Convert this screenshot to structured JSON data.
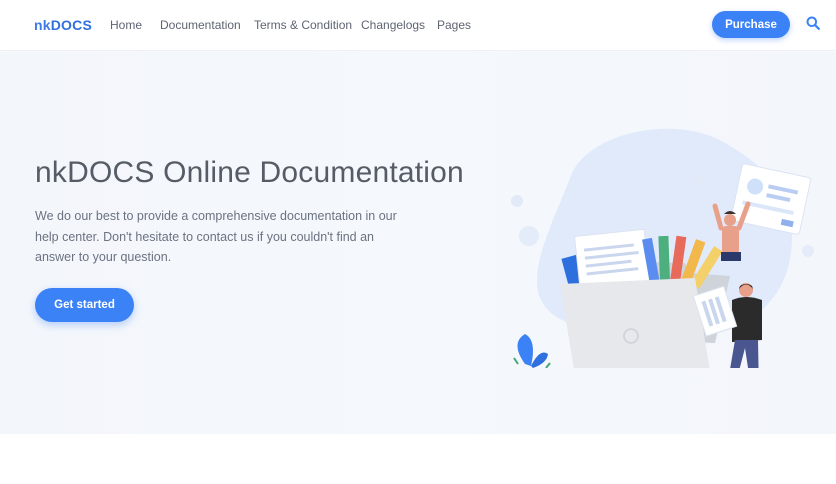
{
  "brand": {
    "prefix": "nk",
    "name": "DOCS"
  },
  "nav": {
    "items": [
      {
        "label": "Home"
      },
      {
        "label": "Documentation"
      },
      {
        "label": "Terms & Condition"
      },
      {
        "label": "Changelogs"
      },
      {
        "label": "Pages"
      }
    ],
    "purchase_label": "Purchase",
    "search_icon": "search-icon"
  },
  "hero": {
    "title": "nkDOCS Online Documentation",
    "description": "We do our best to provide a comprehensive documentation in our help center. Don't hesitate to contact us if you couldn't find an answer to your question.",
    "cta_label": "Get started"
  },
  "colors": {
    "accent": "#3b82f6",
    "brand": "#3d7be6",
    "hero_background": "#f3f6fb"
  }
}
